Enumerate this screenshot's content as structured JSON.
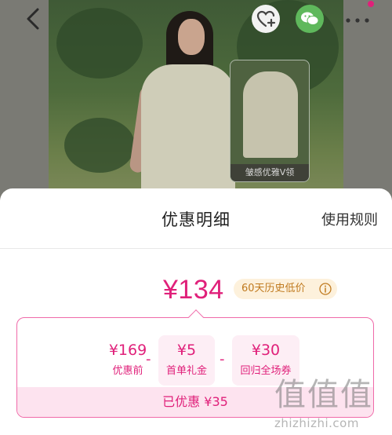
{
  "hero": {
    "thumbnail_caption": "皱感优雅V领"
  },
  "sheet": {
    "title": "优惠明细",
    "rules_link": "使用规则",
    "final_price": "¥134",
    "low_price_badge": "60天历史低价",
    "breakdown": {
      "items": [
        {
          "amount": "¥169",
          "label": "优惠前"
        },
        {
          "amount": "¥5",
          "label": "首单礼金"
        },
        {
          "amount": "¥30",
          "label": "回归全场券"
        }
      ],
      "operators": [
        "-",
        "-"
      ],
      "saved_text": "已优惠 ¥35"
    }
  },
  "watermark": {
    "glyphs": "值值值",
    "url": "zhizhizhi.com"
  },
  "colors": {
    "accent": "#e0207a",
    "badge_bg": "#fdf1dc",
    "badge_text": "#c07a1f",
    "wechat": "#5fb85c"
  },
  "icons": [
    "back-icon",
    "favorite-add-icon",
    "wechat-icon",
    "more-icon",
    "info-icon"
  ]
}
